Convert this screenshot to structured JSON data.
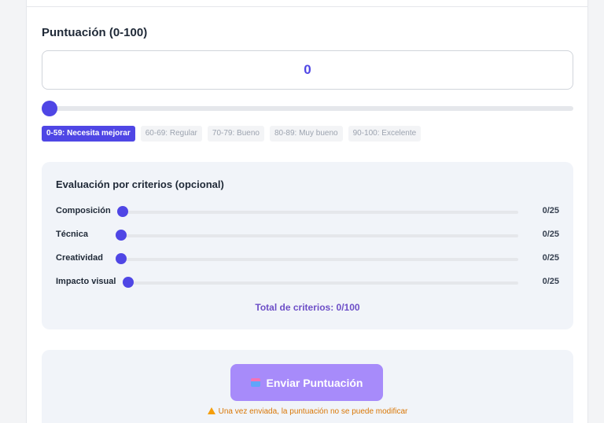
{
  "score": {
    "title": "Puntuación (0-100)",
    "value": "0",
    "slider_value": 0
  },
  "ranges": [
    {
      "label": "0-59: Necesita mejorar",
      "active": true
    },
    {
      "label": "60-69: Regular",
      "active": false
    },
    {
      "label": "70-79: Bueno",
      "active": false
    },
    {
      "label": "80-89: Muy bueno",
      "active": false
    },
    {
      "label": "90-100: Excelente",
      "active": false
    }
  ],
  "criteria": {
    "title": "Evaluación por criterios (opcional)",
    "items": [
      {
        "label": "Composición",
        "value": "0/25"
      },
      {
        "label": "Técnica",
        "value": "0/25"
      },
      {
        "label": "Creatividad",
        "value": "0/25"
      },
      {
        "label": "Impacto visual",
        "value": "0/25"
      }
    ],
    "total": "Total de criterios: 0/100"
  },
  "submit": {
    "label": "Enviar Puntuación",
    "icon": "clipboard-icon",
    "warning": "Una vez enviada, la puntuación no se puede modificar"
  },
  "colors": {
    "accent": "#4f46e5",
    "button": "#a78bfa",
    "warning": "#d97706"
  }
}
